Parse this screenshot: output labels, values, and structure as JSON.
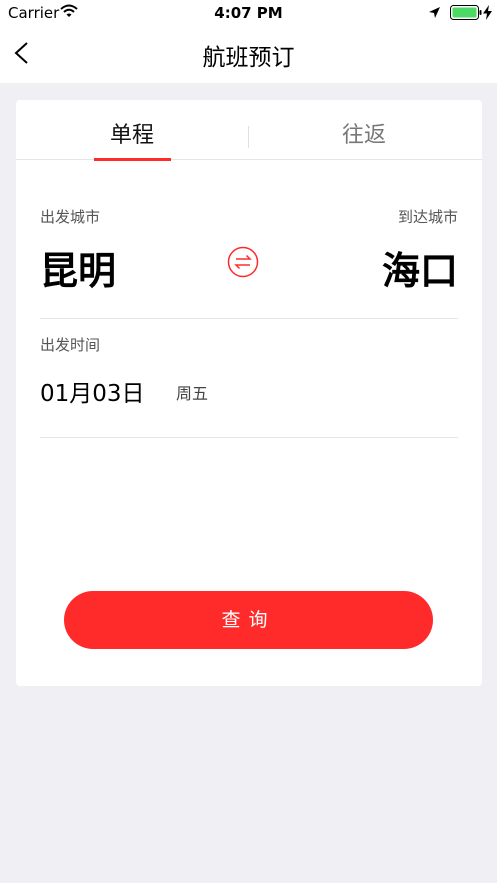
{
  "status_bar": {
    "carrier": "Carrier",
    "time": "4:07 PM"
  },
  "nav": {
    "title": "航班预订"
  },
  "tabs": [
    {
      "label": "单程",
      "selected": true
    },
    {
      "label": "往返",
      "selected": false
    }
  ],
  "route": {
    "departure_label": "出发城市",
    "departure_city": "昆明",
    "arrival_label": "到达城市",
    "arrival_city": "海口"
  },
  "date": {
    "label": "出发时间",
    "value": "01月03日",
    "weekday": "周五"
  },
  "search_button": {
    "label": "查询"
  },
  "colors": {
    "accent": "#ff2b2b",
    "battery": "#4cd964",
    "background": "#efeff4"
  },
  "icons": [
    "wifi-icon",
    "location-arrow-icon",
    "battery-icon",
    "charging-icon",
    "back-chevron-icon",
    "swap-arrows-icon"
  ]
}
